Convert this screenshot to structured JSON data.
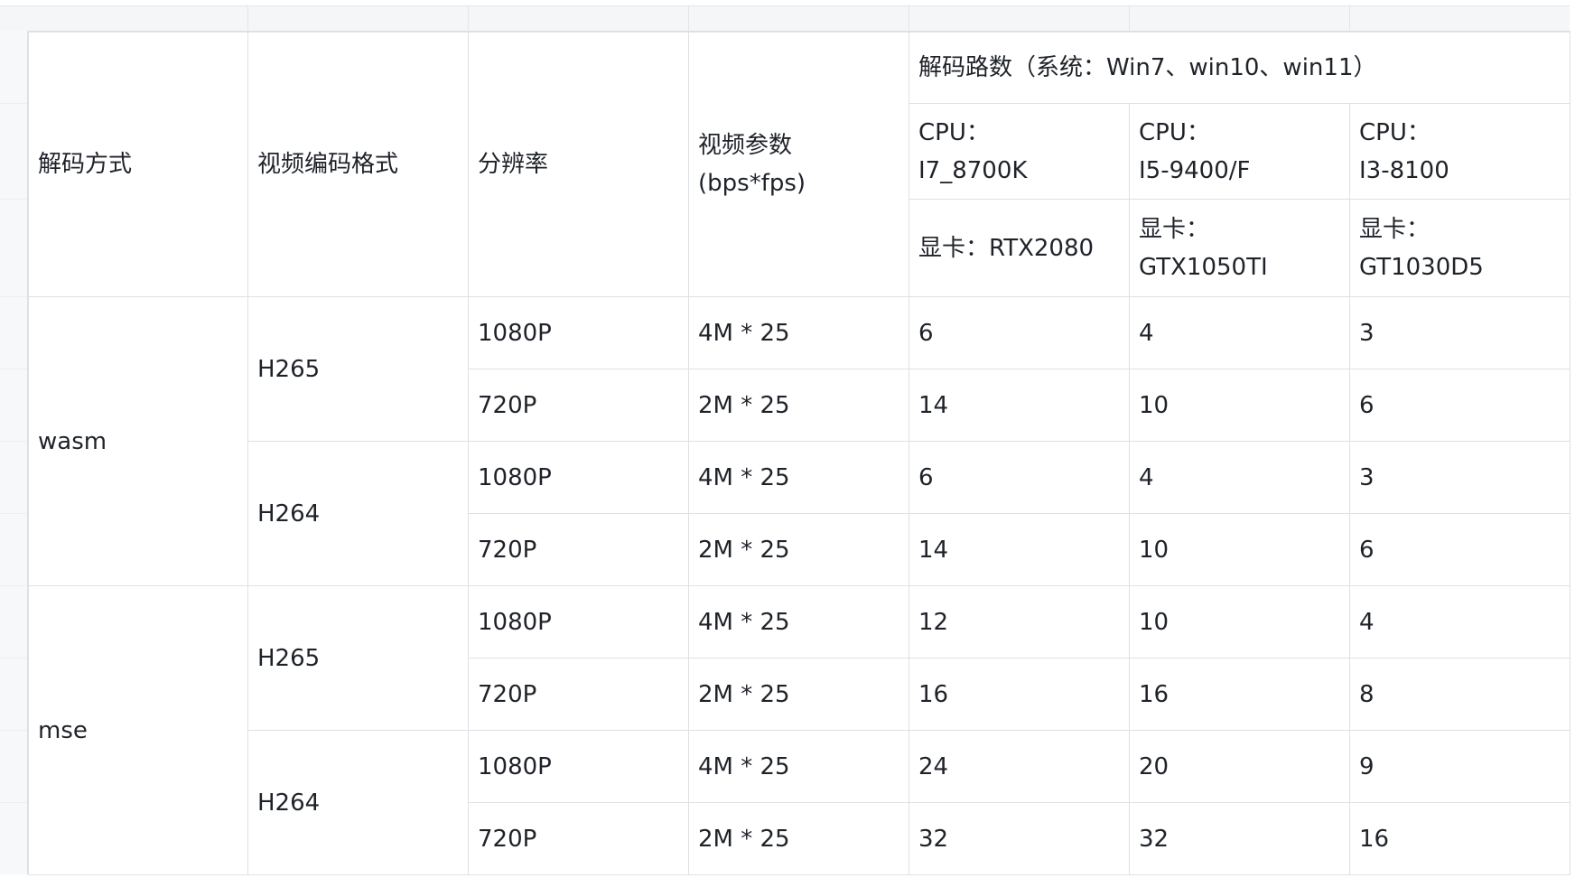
{
  "header": {
    "decode_method": "解码方式",
    "video_codec": "视频编码格式",
    "resolution": "分辨率",
    "video_params_line1": "视频参数",
    "video_params_line2": "(bps*fps)",
    "decode_channels": "解码路数（系统：Win7、win10、win11）",
    "configs": [
      {
        "cpu_label": "CPU：",
        "cpu": "I7_8700K",
        "gpu_label": "显卡：",
        "gpu": "RTX2080"
      },
      {
        "cpu_label": "CPU：",
        "cpu": "I5-9400/F",
        "gpu_label": "显卡：",
        "gpu": "GTX1050TI"
      },
      {
        "cpu_label": "CPU：",
        "cpu": "I3-8100",
        "gpu_label": "显卡：",
        "gpu": "GT1030D5"
      }
    ]
  },
  "methods": [
    {
      "name": "wasm",
      "codecs": [
        {
          "name": "H265",
          "rows": [
            {
              "resolution": "1080P",
              "params": "4M * 25",
              "values": [
                "6",
                "4",
                "3"
              ]
            },
            {
              "resolution": "720P",
              "params": "2M * 25",
              "values": [
                "14",
                "10",
                "6"
              ]
            }
          ]
        },
        {
          "name": "H264",
          "rows": [
            {
              "resolution": "1080P",
              "params": "4M * 25",
              "values": [
                "6",
                "4",
                "3"
              ]
            },
            {
              "resolution": "720P",
              "params": "2M * 25",
              "values": [
                "14",
                "10",
                "6"
              ]
            }
          ]
        }
      ]
    },
    {
      "name": "mse",
      "codecs": [
        {
          "name": "H265",
          "rows": [
            {
              "resolution": "1080P",
              "params": "4M * 25",
              "values": [
                "12",
                "10",
                "4"
              ]
            },
            {
              "resolution": "720P",
              "params": "2M * 25",
              "values": [
                "16",
                "16",
                "8"
              ]
            }
          ]
        },
        {
          "name": "H264",
          "rows": [
            {
              "resolution": "1080P",
              "params": "4M * 25",
              "values": [
                "24",
                "20",
                "9"
              ]
            },
            {
              "resolution": "720P",
              "params": "2M * 25",
              "values": [
                "32",
                "32",
                "16"
              ]
            }
          ]
        }
      ]
    }
  ]
}
